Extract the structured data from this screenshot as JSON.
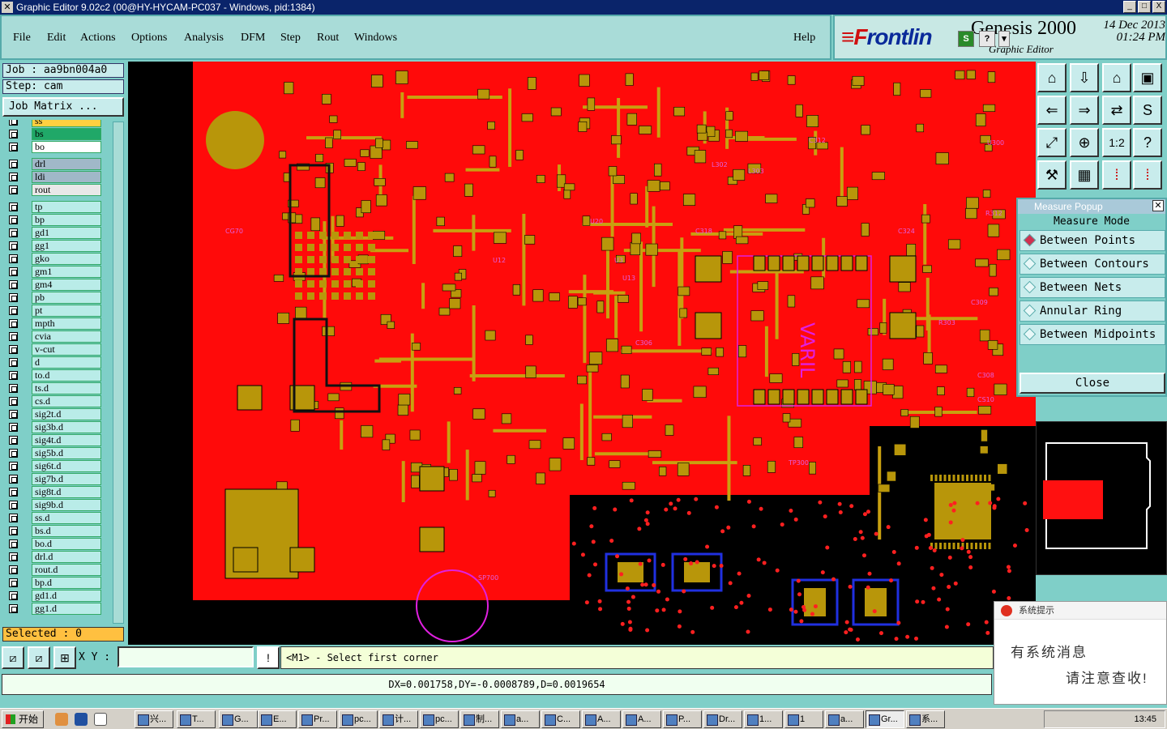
{
  "window": {
    "title": "Graphic Editor 9.02c2 (00@HY-HYCAM-PC037 - Windows, pid:1384)",
    "buttons": [
      "_",
      "□",
      "X"
    ]
  },
  "menu": {
    "items": [
      "File",
      "Edit",
      "Actions",
      "Options",
      "Analysis",
      "DFM",
      "Step",
      "Rout",
      "Windows"
    ],
    "help": "Help"
  },
  "brand": {
    "logo_red": "≡F",
    "logo_blue": "rontlin",
    "product": "Genesis 2000",
    "subtitle": "Graphic Editor",
    "date": "14 Dec 2013",
    "time": "01:24 PM",
    "mini_buttons": [
      "S",
      "?",
      "▾"
    ]
  },
  "left": {
    "job": "Job : aa9bn004a0",
    "step": "Step: cam",
    "job_matrix": "Job Matrix ...",
    "selected": "Selected : 0",
    "layers": [
      {
        "name": "ss",
        "color": "#ffd040"
      },
      {
        "name": "bs",
        "color": "#20a868"
      },
      {
        "name": "bo",
        "color": "#ffffff"
      },
      {
        "name": "drl",
        "color": "#a0b8c8"
      },
      {
        "name": "ldi",
        "color": "#a0b8c8"
      },
      {
        "name": "rout",
        "color": "#e8e8e8"
      },
      {
        "name": "tp",
        "color": "#b9ece8"
      },
      {
        "name": "bp",
        "color": "#b9ece8"
      },
      {
        "name": "gd1",
        "color": "#b9ece8"
      },
      {
        "name": "gg1",
        "color": "#b9ece8"
      },
      {
        "name": "gko",
        "color": "#b9ece8"
      },
      {
        "name": "gm1",
        "color": "#b9ece8"
      },
      {
        "name": "gm4",
        "color": "#b9ece8"
      },
      {
        "name": "pb",
        "color": "#b9ece8"
      },
      {
        "name": "pt",
        "color": "#b9ece8"
      },
      {
        "name": "mpth",
        "color": "#b9ece8"
      },
      {
        "name": "cvia",
        "color": "#b9ece8"
      },
      {
        "name": "v-cut",
        "color": "#b9ece8"
      },
      {
        "name": "d",
        "color": "#b9ece8"
      },
      {
        "name": "to.d",
        "color": "#b9ece8"
      },
      {
        "name": "ts.d",
        "color": "#b9ece8"
      },
      {
        "name": "cs.d",
        "color": "#b9ece8"
      },
      {
        "name": "sig2t.d",
        "color": "#b9ece8"
      },
      {
        "name": "sig3b.d",
        "color": "#b9ece8"
      },
      {
        "name": "sig4t.d",
        "color": "#b9ece8"
      },
      {
        "name": "sig5b.d",
        "color": "#b9ece8"
      },
      {
        "name": "sig6t.d",
        "color": "#b9ece8"
      },
      {
        "name": "sig7b.d",
        "color": "#b9ece8"
      },
      {
        "name": "sig8t.d",
        "color": "#b9ece8"
      },
      {
        "name": "sig9b.d",
        "color": "#b9ece8"
      },
      {
        "name": "ss.d",
        "color": "#b9ece8"
      },
      {
        "name": "bs.d",
        "color": "#b9ece8"
      },
      {
        "name": "bo.d",
        "color": "#b9ece8"
      },
      {
        "name": "drl.d",
        "color": "#b9ece8"
      },
      {
        "name": "rout.d",
        "color": "#b9ece8"
      },
      {
        "name": "bp.d",
        "color": "#b9ece8"
      },
      {
        "name": "gd1.d",
        "color": "#b9ece8"
      },
      {
        "name": "gg1.d",
        "color": "#b9ece8"
      }
    ]
  },
  "canvas": {
    "board_color": "#ff0a0a",
    "pad_color": "#b8960a",
    "trace_color": "#c8a010",
    "outline_color": "#e020e0",
    "labels": [
      "VARIL",
      "U3",
      "U13",
      "U12",
      "U20",
      "C309",
      "C312",
      "C318",
      "C324",
      "R303",
      "C306",
      "SP700",
      "CG70",
      "L302",
      "L303",
      "R312",
      "U300",
      "C308",
      "CS10",
      "TP300"
    ]
  },
  "measure": {
    "title": "Measure Popup",
    "heading": "Measure Mode",
    "options": [
      "Between Points",
      "Between Contours",
      "Between Nets",
      "Annular Ring",
      "Between Midpoints"
    ],
    "selected": "Between Points",
    "close": "Close"
  },
  "command": {
    "xy_label": "X Y :",
    "xy_value": "",
    "bang": "!",
    "prompt": "<M1> - Select first corner",
    "status": "DX=0.001758,DY=-0.0008789,D=0.0019654"
  },
  "notify": {
    "header": "系统提示",
    "line1": "有系统消息",
    "line2": "请注意查收!"
  },
  "taskbar": {
    "start": "开始",
    "tasks": [
      "兴...",
      "T...",
      "G...",
      "E...",
      "Pr...",
      "pc...",
      "计...",
      "pc...",
      "制...",
      "a...",
      "C...",
      "A...",
      "A...",
      "P...",
      "Dr...",
      "1...",
      "1",
      "a...",
      "Gr...",
      "系..."
    ],
    "clock": "13:45"
  }
}
